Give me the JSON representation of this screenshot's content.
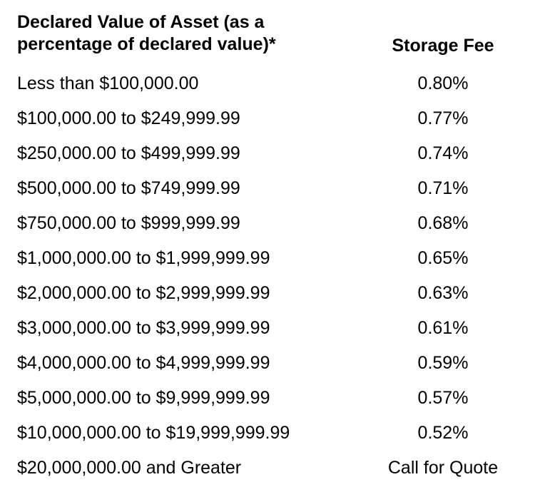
{
  "table": {
    "header_left": "Declared Value of Asset (as a percentage of declared value)*",
    "header_right": "Storage Fee",
    "rows": [
      {
        "value": "Less than $100,000.00",
        "fee": "0.80%"
      },
      {
        "value": "$100,000.00 to $249,999.99",
        "fee": "0.77%"
      },
      {
        "value": "$250,000.00 to $499,999.99",
        "fee": "0.74%"
      },
      {
        "value": "$500,000.00 to $749,999.99",
        "fee": "0.71%"
      },
      {
        "value": "$750,000.00 to $999,999.99",
        "fee": "0.68%"
      },
      {
        "value": "$1,000,000.00 to $1,999,999.99",
        "fee": "0.65%"
      },
      {
        "value": "$2,000,000.00 to $2,999,999.99",
        "fee": "0.63%"
      },
      {
        "value": "$3,000,000.00 to $3,999,999.99",
        "fee": "0.61%"
      },
      {
        "value": "$4,000,000.00 to $4,999,999.99",
        "fee": "0.59%"
      },
      {
        "value": "$5,000,000.00 to $9,999,999.99",
        "fee": "0.57%"
      },
      {
        "value": "$10,000,000.00 to $19,999,999.99",
        "fee": "0.52%"
      },
      {
        "value": "$20,000,000.00 and Greater",
        "fee": "Call for Quote"
      }
    ]
  },
  "chart_data": {
    "type": "table",
    "columns": [
      "Declared Value of Asset (as a percentage of declared value)*",
      "Storage Fee"
    ],
    "rows": [
      [
        "Less than $100,000.00",
        "0.80%"
      ],
      [
        "$100,000.00 to $249,999.99",
        "0.77%"
      ],
      [
        "$250,000.00 to $499,999.99",
        "0.74%"
      ],
      [
        "$500,000.00 to $749,999.99",
        "0.71%"
      ],
      [
        "$750,000.00 to $999,999.99",
        "0.68%"
      ],
      [
        "$1,000,000.00 to $1,999,999.99",
        "0.65%"
      ],
      [
        "$2,000,000.00 to $2,999,999.99",
        "0.63%"
      ],
      [
        "$3,000,000.00 to $3,999,999.99",
        "0.61%"
      ],
      [
        "$4,000,000.00 to $4,999,999.99",
        "0.59%"
      ],
      [
        "$5,000,000.00 to $9,999,999.99",
        "0.57%"
      ],
      [
        "$10,000,000.00 to $19,999,999.99",
        "0.52%"
      ],
      [
        "$20,000,000.00 and Greater",
        "Call for Quote"
      ]
    ]
  }
}
